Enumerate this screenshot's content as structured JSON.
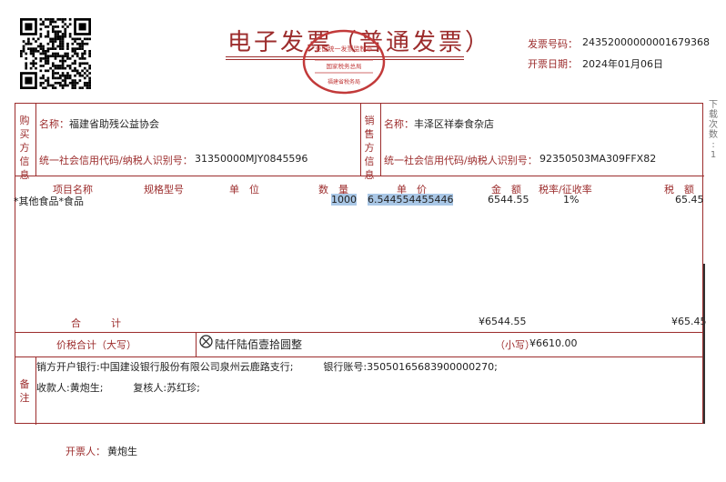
{
  "title": "电子发票（普通发票）",
  "seal": {
    "top_text": "全国统一发票监制章",
    "middle_text": "国家税务总局",
    "bottom_text": "福建省税务局"
  },
  "header": {
    "invoice_number_label": "发票号码：",
    "invoice_number": "24352000000001679368",
    "issue_date_label": "开票日期：",
    "issue_date": "2024年01月06日"
  },
  "buyer": {
    "side_label": "购买方信息",
    "name_label": "名称：",
    "name": "福建省助残公益协会",
    "tax_id_label": "统一社会信用代码/纳税人识别号：",
    "tax_id": "31350000MJY0845596"
  },
  "seller": {
    "side_label": "销售方信息",
    "name_label": "名称：",
    "name": "丰泽区祥泰食杂店",
    "tax_id_label": "统一社会信用代码/纳税人识别号：",
    "tax_id": "92350503MA309FFX82"
  },
  "items_table": {
    "headers": {
      "item": "项目名称",
      "spec": "规格型号",
      "unit": "单　位",
      "qty": "数　量",
      "price": "单　价",
      "amount": "金　额",
      "rate": "税率/征收率",
      "tax": "税　额"
    },
    "rows": [
      {
        "item": "*其他食品*食品",
        "spec": "",
        "unit": "",
        "qty": "1000",
        "price": "6.544554455446",
        "amount": "6544.55",
        "rate": "1%",
        "tax": "65.45"
      }
    ],
    "total_label": "合　　　计",
    "total_amount": "¥6544.55",
    "total_tax": "¥65.45"
  },
  "grand_total": {
    "label": "价税合计（大写）",
    "icon": "circle-x-icon",
    "amount_words": "陆仟陆佰壹拾圆整",
    "small_label": "（小写）",
    "amount": "¥6610.00"
  },
  "remarks": {
    "side_label": "备注",
    "line1": "销方开户银行:中国建设银行股份有限公司泉州云鹿路支行;　　　银行账号:35050165683900000270;",
    "line2": "收款人:黄炮生;　　　复核人:苏红珍;"
  },
  "issuer": {
    "label": "开票人：",
    "name": "黄炮生"
  },
  "side_note": [
    "下",
    "载",
    "次",
    "数",
    ":",
    "1"
  ],
  "colors": {
    "accent_red": "#9c2c2c",
    "selection": "#a9c7e6"
  }
}
